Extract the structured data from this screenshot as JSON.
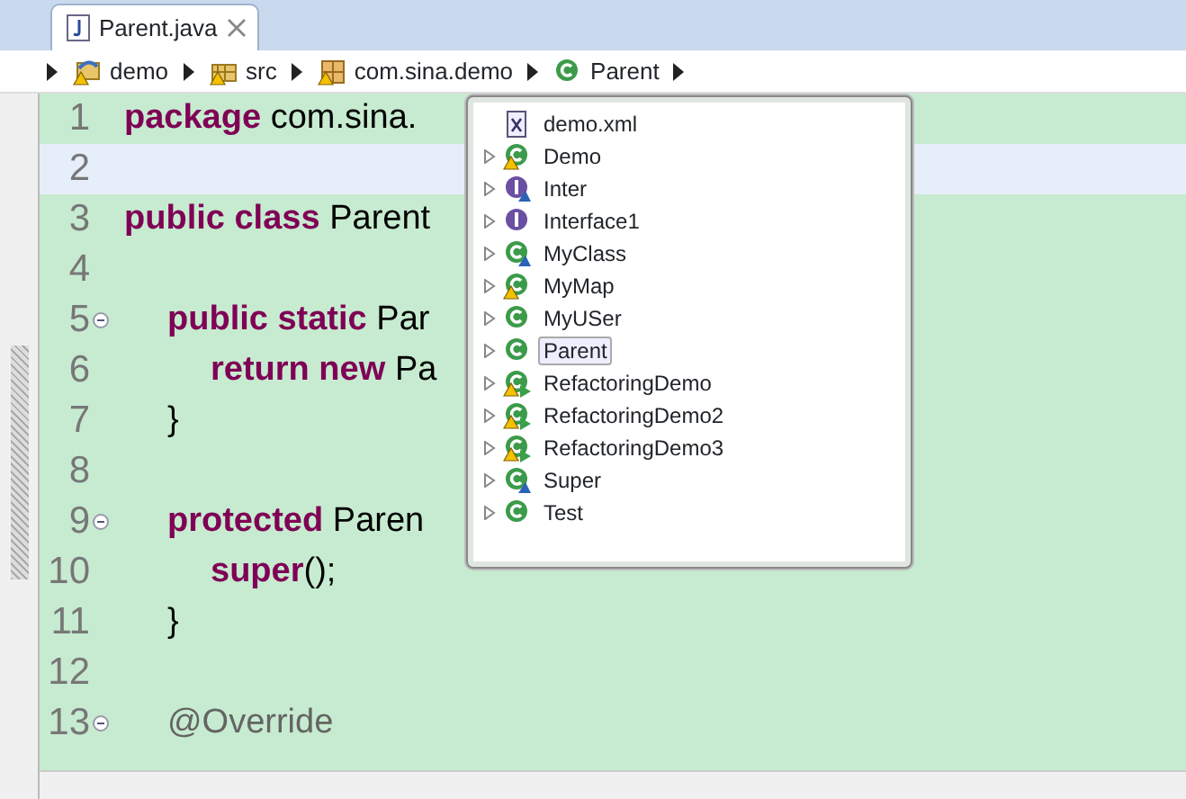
{
  "tab": {
    "title": "Parent.java",
    "selected": true
  },
  "breadcrumb": [
    {
      "label": "demo",
      "kind": "project"
    },
    {
      "label": "src",
      "kind": "source-folder"
    },
    {
      "label": "com.sina.demo",
      "kind": "package"
    },
    {
      "label": "Parent",
      "kind": "class"
    }
  ],
  "editor": {
    "lines": [
      {
        "number": "1",
        "foldable": false,
        "current": false,
        "kind": "top",
        "tokens": [
          {
            "text": "package",
            "kind": "keyword"
          },
          {
            "text": "com.sina.",
            "kind": "plain"
          }
        ]
      },
      {
        "number": "2",
        "foldable": false,
        "current": true
      },
      {
        "number": "3",
        "foldable": false,
        "current": false,
        "kind": "top",
        "tokens": [
          {
            "text": "public class",
            "kind": "keyword"
          },
          {
            "text": "Parent",
            "kind": "plain"
          }
        ]
      },
      {
        "number": "4",
        "foldable": false,
        "current": false
      },
      {
        "number": "5",
        "foldable": true,
        "current": false,
        "kind": "member",
        "tokens": [
          {
            "text": "public static",
            "kind": "keyword"
          },
          {
            "text": "Par",
            "kind": "plain"
          }
        ]
      },
      {
        "number": "6",
        "foldable": false,
        "current": false,
        "kind": "statement",
        "tokens": [
          {
            "text": "return new",
            "kind": "keyword"
          },
          {
            "text": "Pa",
            "kind": "plain"
          }
        ]
      },
      {
        "number": "7",
        "foldable": false,
        "current": false,
        "kind": "member",
        "tokens": [
          {
            "text": "}",
            "kind": "plain"
          }
        ]
      },
      {
        "number": "8",
        "foldable": false,
        "current": false
      },
      {
        "number": "9",
        "foldable": true,
        "current": false,
        "kind": "member",
        "tokens": [
          {
            "text": "protected",
            "kind": "keyword"
          },
          {
            "text": "Paren",
            "kind": "plain"
          }
        ]
      },
      {
        "number": "10",
        "foldable": false,
        "current": false,
        "kind": "statement",
        "tokens": [
          {
            "text": "super",
            "kind": "keyword"
          },
          {
            "text": "();",
            "kind": "punct"
          }
        ]
      },
      {
        "number": "11",
        "foldable": false,
        "current": false,
        "kind": "member",
        "tokens": [
          {
            "text": "}",
            "kind": "plain"
          }
        ]
      },
      {
        "number": "12",
        "foldable": false,
        "current": false
      },
      {
        "number": "13",
        "foldable": true,
        "current": false,
        "kind": "member",
        "tokens": [
          {
            "text": "@Override",
            "kind": "annotation"
          }
        ]
      }
    ]
  },
  "popup": {
    "items": [
      {
        "label": "demo.xml",
        "kind": "xml",
        "expandable": false,
        "selected": false
      },
      {
        "label": "Demo",
        "kind": "class-warning",
        "expandable": true,
        "selected": false
      },
      {
        "label": "Inter",
        "kind": "interface-shared",
        "expandable": true,
        "selected": false
      },
      {
        "label": "Interface1",
        "kind": "interface",
        "expandable": true,
        "selected": false
      },
      {
        "label": "MyClass",
        "kind": "class-shared",
        "expandable": true,
        "selected": false
      },
      {
        "label": "MyMap",
        "kind": "class-warning",
        "expandable": true,
        "selected": false
      },
      {
        "label": "MyUSer",
        "kind": "class",
        "expandable": true,
        "selected": false
      },
      {
        "label": "Parent",
        "kind": "class",
        "expandable": true,
        "selected": true
      },
      {
        "label": "RefactoringDemo",
        "kind": "class-run-warning",
        "expandable": true,
        "selected": false
      },
      {
        "label": "RefactoringDemo2",
        "kind": "class-run-warning",
        "expandable": true,
        "selected": false
      },
      {
        "label": "RefactoringDemo3",
        "kind": "class-run-warning",
        "expandable": true,
        "selected": false
      },
      {
        "label": "Super",
        "kind": "class-shared",
        "expandable": true,
        "selected": false
      },
      {
        "label": "Test",
        "kind": "class",
        "expandable": true,
        "selected": false
      }
    ]
  }
}
